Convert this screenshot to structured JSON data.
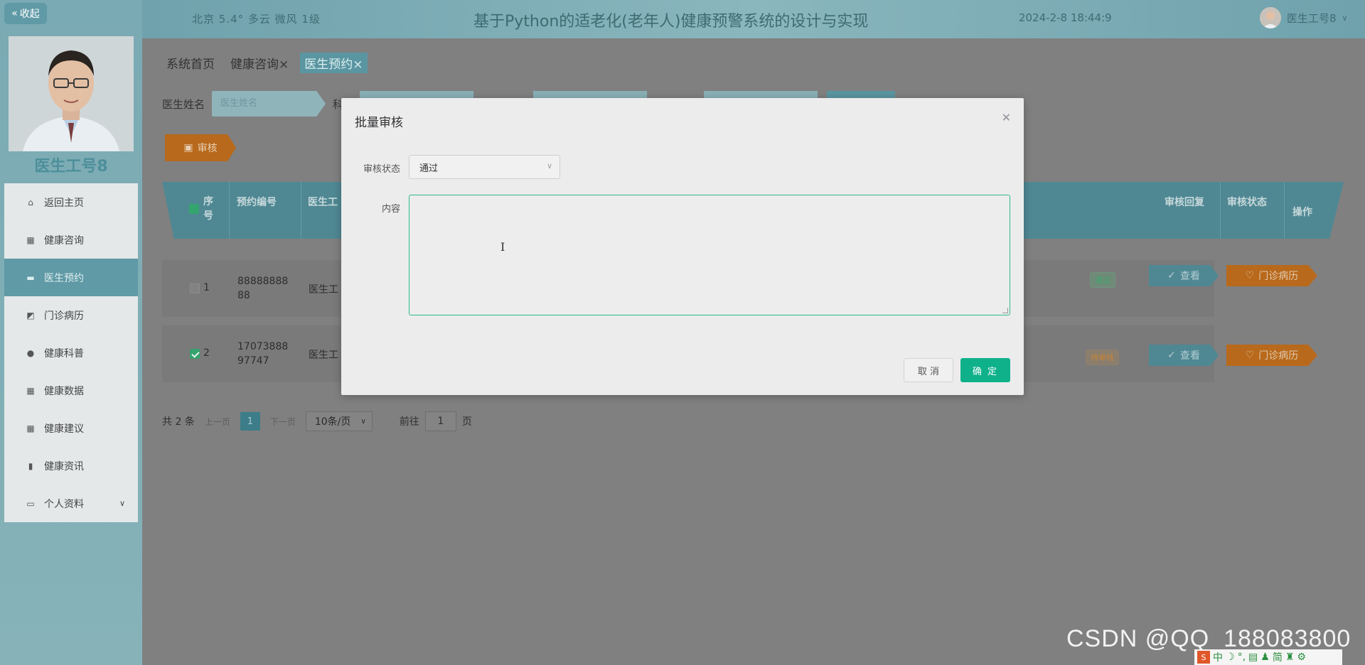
{
  "sidebar": {
    "collapse_label": "收起",
    "user_name": "医生工号8",
    "menu": [
      {
        "label": "返回主页",
        "icon": "home-icon",
        "active": false
      },
      {
        "label": "健康咨询",
        "icon": "grid-icon",
        "active": false
      },
      {
        "label": "医生预约",
        "icon": "monitor-icon",
        "active": true
      },
      {
        "label": "门诊病历",
        "icon": "chart-box-icon",
        "active": false
      },
      {
        "label": "健康科普",
        "icon": "location-icon",
        "active": false
      },
      {
        "label": "健康数据",
        "icon": "grid-icon",
        "active": false
      },
      {
        "label": "健康建议",
        "icon": "grid-icon",
        "active": false
      },
      {
        "label": "健康资讯",
        "icon": "bar-chart-icon",
        "active": false
      },
      {
        "label": "个人资料",
        "icon": "card-icon",
        "active": false
      }
    ]
  },
  "header": {
    "weather": "北京 5.4° 多云 微风 1级",
    "title": "基于Python的适老化(老年人)健康预警系统的设计与实现",
    "datetime": "2024-2-8 18:44:9",
    "user": "医生工号8"
  },
  "breadcrumbs": [
    "系统首页",
    "健康咨询",
    "医生预约"
  ],
  "search": {
    "doctor_label": "医生姓名",
    "doctor_placeholder": "医生姓名",
    "next_label": "科"
  },
  "toolbar": {
    "audit_label": "审核"
  },
  "table": {
    "headers": {
      "index": "序号",
      "booking_no": "预约编号",
      "doctor_no": "医生工",
      "reply": "审核回复",
      "status": "审核状态",
      "ops": "操作"
    },
    "rows": [
      {
        "index": "1",
        "booking_no": "8888888888",
        "doctor_no": "医生工",
        "status": "通过",
        "checked": false
      },
      {
        "index": "2",
        "booking_no": "1707388897747",
        "doctor_no": "医生工",
        "status": "待审核",
        "checked": true
      }
    ],
    "view_label": "查看",
    "record_label": "门诊病历"
  },
  "pager": {
    "total": "共 2 条",
    "prev": "上一页",
    "page": "1",
    "next": "下一页",
    "page_size": "10条/页",
    "goto_prefix": "前往",
    "goto_value": "1",
    "goto_suffix": "页"
  },
  "dialog": {
    "title": "批量审核",
    "status_label": "审核状态",
    "status_value": "通过",
    "content_label": "内容",
    "cancel_label": "取 消",
    "ok_label": "确 定"
  },
  "watermark": "CSDN @QQ_188083800",
  "ime": [
    "中",
    "简"
  ]
}
